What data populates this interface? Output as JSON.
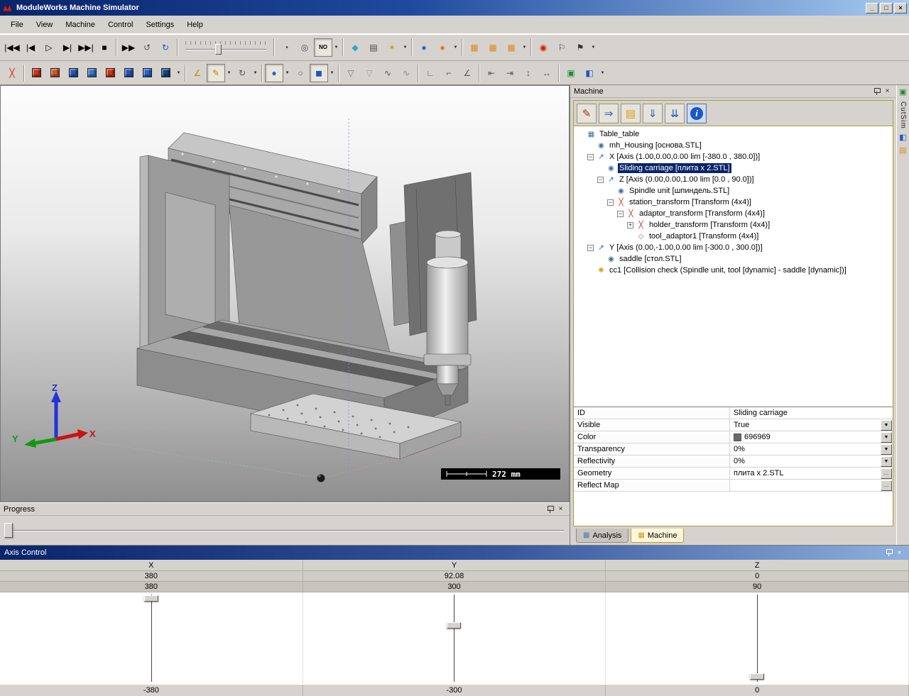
{
  "palette": {
    "titlebar_gradient_start": "#0a246a",
    "titlebar_gradient_end": "#a6caf0",
    "window_chrome": "#d6d3ce",
    "selection_blue": "#0a246a",
    "panel_frame_gold": "#b09b3c",
    "accent_blue": "#1a57c8",
    "accent_red": "#cc2200",
    "accent_orange": "#dd8822"
  },
  "window": {
    "title": "ModuleWorks Machine Simulator",
    "controls": [
      {
        "name": "minimize-button",
        "g": "_"
      },
      {
        "name": "restore-button",
        "g": "□"
      },
      {
        "name": "close-button",
        "g": "×"
      }
    ]
  },
  "menu": {
    "items": [
      "File",
      "View",
      "Machine",
      "Control",
      "Settings",
      "Help"
    ]
  },
  "toolbar1": [
    {
      "t": "btn",
      "name": "go-to-start-button",
      "g": "|◀◀"
    },
    {
      "t": "btn",
      "name": "step-back-button",
      "g": "|◀"
    },
    {
      "t": "btn",
      "name": "play-button",
      "g": "▷"
    },
    {
      "t": "btn",
      "name": "step-forward-button",
      "g": "▶|"
    },
    {
      "t": "btn",
      "name": "go-to-end-button",
      "g": "▶▶|"
    },
    {
      "t": "btn",
      "name": "stop-button",
      "g": "■"
    },
    {
      "t": "sep"
    },
    {
      "t": "btn",
      "name": "fast-forward-button",
      "g": "▶▶"
    },
    {
      "t": "btn",
      "name": "simulation-restart-button",
      "g": "↺",
      "c": "#555555"
    },
    {
      "t": "btn",
      "name": "refresh-simulation-button",
      "g": "↻",
      "c": "#1a57c8"
    },
    {
      "t": "sep"
    },
    {
      "t": "slider",
      "name": "simulation-speed-slider"
    },
    {
      "t": "sep"
    },
    {
      "t": "btn",
      "name": "clock-speed-button",
      "g": "◔",
      "c": "#333333"
    },
    {
      "t": "btn",
      "name": "gauge-speed-button",
      "g": "◎",
      "c": "#555555"
    },
    {
      "t": "btn",
      "name": "no-speed-limit-button",
      "g": "NO",
      "small": true,
      "pressed": true
    },
    {
      "t": "dd"
    },
    {
      "t": "sep"
    },
    {
      "t": "btn",
      "name": "gem-quality-button",
      "g": "◆",
      "c": "#2aa8c8"
    },
    {
      "t": "btn",
      "name": "keyboard-control-button",
      "g": "▤",
      "c": "#444444"
    },
    {
      "t": "btn",
      "name": "machine-settings-button",
      "g": "✶",
      "c": "#c8a020"
    },
    {
      "t": "dd"
    },
    {
      "t": "sep"
    },
    {
      "t": "btn",
      "name": "world-view-button",
      "g": "●",
      "c": "#2266cc"
    },
    {
      "t": "btn",
      "name": "material-sphere-button",
      "g": "●",
      "c": "#dd7711"
    },
    {
      "t": "dd"
    },
    {
      "t": "sep"
    },
    {
      "t": "btn",
      "name": "stock-wireframe-button",
      "g": "▦",
      "c": "#dd8822"
    },
    {
      "t": "btn",
      "name": "stock-solid-button",
      "g": "▦",
      "c": "#dd8822"
    },
    {
      "t": "btn",
      "name": "stock-transparent-button",
      "g": "▦",
      "c": "#dd8822"
    },
    {
      "t": "dd"
    },
    {
      "t": "sep"
    },
    {
      "t": "btn",
      "name": "marker-pin-button",
      "g": "◉",
      "c": "#cc2200"
    },
    {
      "t": "btn",
      "name": "flag-outline-button",
      "g": "⚐",
      "c": "#333333"
    },
    {
      "t": "btn",
      "name": "flag-solid-button",
      "g": "⚑",
      "c": "#333333"
    },
    {
      "t": "dd"
    }
  ],
  "toolbar2": [
    {
      "t": "btn",
      "name": "transform-move-button",
      "g": "╳",
      "c": "#cc2200"
    },
    {
      "t": "sep"
    },
    {
      "t": "cube",
      "name": "view-iso-button",
      "c": "#cc3311"
    },
    {
      "t": "cube",
      "name": "view-front-button",
      "c": "#cc5522"
    },
    {
      "t": "cube",
      "name": "view-back-button",
      "c": "#2255bb"
    },
    {
      "t": "cube",
      "name": "view-left-button",
      "c": "#3377cc"
    },
    {
      "t": "cube",
      "name": "view-right-button",
      "c": "#cc3311"
    },
    {
      "t": "cube",
      "name": "view-top-button",
      "c": "#2255bb"
    },
    {
      "t": "cube",
      "name": "view-bottom-button",
      "c": "#2266cc"
    },
    {
      "t": "cube",
      "name": "view-iso2-button",
      "c": "#114488"
    },
    {
      "t": "dd"
    },
    {
      "t": "sep"
    },
    {
      "t": "btn",
      "name": "measure-angle-button",
      "g": "∠",
      "c": "#b8860b"
    },
    {
      "t": "btn",
      "name": "measure-edit-button",
      "g": "✎",
      "c": "#b8860b",
      "pressed": true
    },
    {
      "t": "dd"
    },
    {
      "t": "btn",
      "name": "rotate-tool-button",
      "g": "↻",
      "c": "#555555"
    },
    {
      "t": "dd"
    },
    {
      "t": "sep"
    },
    {
      "t": "btn",
      "name": "shaded-view-button",
      "g": "●",
      "c": "#2266cc",
      "pressed": true
    },
    {
      "t": "dd"
    },
    {
      "t": "btn",
      "name": "wireframe-view-button",
      "g": "○",
      "c": "#555555"
    },
    {
      "t": "btn",
      "name": "solid-view-button",
      "g": "◼",
      "c": "#2255bb",
      "pressed": true
    },
    {
      "t": "dd"
    },
    {
      "t": "sep"
    },
    {
      "t": "btn",
      "name": "coolant-off-button",
      "g": "▽",
      "c": "#777777"
    },
    {
      "t": "btn",
      "name": "coolant-on-button",
      "g": "▽",
      "c": "#999999"
    },
    {
      "t": "btn",
      "name": "toolpath-curve-button",
      "g": "∿",
      "c": "#555555"
    },
    {
      "t": "btn",
      "name": "toolpath-curve2-button",
      "g": "∿",
      "c": "#888888"
    },
    {
      "t": "sep"
    },
    {
      "t": "btn",
      "name": "corner-detect-button",
      "g": "∟",
      "c": "#555555"
    },
    {
      "t": "btn",
      "name": "corner-radius-button",
      "g": "⌐",
      "c": "#555555"
    },
    {
      "t": "btn",
      "name": "corner-angle-button",
      "g": "∠",
      "c": "#555555"
    },
    {
      "t": "sep"
    },
    {
      "t": "btn",
      "name": "measure-width-button",
      "g": "⇤",
      "c": "#555555"
    },
    {
      "t": "btn",
      "name": "measure-length-button",
      "g": "⇥",
      "c": "#555555"
    },
    {
      "t": "btn",
      "name": "measure-height-button",
      "g": "↕",
      "c": "#555555"
    },
    {
      "t": "btn",
      "name": "measure-distance-button",
      "g": "↔",
      "c": "#555555"
    },
    {
      "t": "sep"
    },
    {
      "t": "btn",
      "name": "screenshot-button",
      "g": "▣",
      "c": "#228833"
    },
    {
      "t": "btn",
      "name": "render-export-button",
      "g": "◧",
      "c": "#2255bb"
    },
    {
      "t": "dd"
    }
  ],
  "viewport": {
    "scale_bar": "272 mm",
    "axis_labels": {
      "x": "X",
      "y": "Y",
      "z": "Z"
    },
    "axis_colors": {
      "x": "#cc0000",
      "y": "#119911",
      "z": "#2233cc"
    }
  },
  "machine_panel": {
    "title": "Machine",
    "toolbar": [
      {
        "name": "edit-machine-button",
        "g": "✎",
        "c": "#aa3322"
      },
      {
        "name": "load-machine-button",
        "g": "⇒",
        "c": "#1a57c8"
      },
      {
        "name": "open-machine-folder-button",
        "g": "▤",
        "c": "#d4a017"
      },
      {
        "name": "save-machine-button",
        "g": "⇓",
        "c": "#1a57c8"
      },
      {
        "name": "save-machine-as-button",
        "g": "⇊",
        "c": "#1a57c8"
      },
      {
        "name": "machine-info-button",
        "g": "i",
        "info": true,
        "pressed": true
      }
    ],
    "tree": [
      {
        "d": 0,
        "box": null,
        "icon": "machine-root-icon",
        "ig": "▦",
        "ic": "#3a6ea5",
        "label": "Table_table"
      },
      {
        "d": 1,
        "box": null,
        "icon": "geometry-icon",
        "ig": "◉",
        "ic": "#3a6ea5",
        "label": "mh_Housing [основа.STL]"
      },
      {
        "d": 1,
        "box": "-",
        "icon": "linear-axis-icon",
        "ig": "↗",
        "ic": "#1a57c8",
        "label": "X [Axis (1.00,0.00,0.00 lim [-380.0 , 380.0])]"
      },
      {
        "d": 2,
        "box": null,
        "icon": "geometry-icon",
        "ig": "◉",
        "ic": "#3a6ea5",
        "label": "Sliding carriage [плита x 2.STL]",
        "selected": true
      },
      {
        "d": 2,
        "box": "-",
        "icon": "linear-axis-icon",
        "ig": "↗",
        "ic": "#1a57c8",
        "label": "Z [Axis (0.00,0.00,1.00 lim [0.0 , 90.0])]"
      },
      {
        "d": 3,
        "box": null,
        "icon": "geometry-icon",
        "ig": "◉",
        "ic": "#3a6ea5",
        "label": "Spindle unit [шпиндель.STL]"
      },
      {
        "d": 3,
        "box": "-",
        "icon": "transform-icon",
        "ig": "╳",
        "ic": "#cc2200",
        "label": "station_transform [Transform (4x4)]"
      },
      {
        "d": 4,
        "box": "-",
        "icon": "transform-icon",
        "ig": "╳",
        "ic": "#cc2200",
        "label": "adaptor_transform [Transform (4x4)]"
      },
      {
        "d": 5,
        "box": "+",
        "icon": "transform-icon",
        "ig": "╳",
        "ic": "#cc2200",
        "label": "holder_transform [Transform (4x4)]"
      },
      {
        "d": 5,
        "box": null,
        "icon": "tool-adaptor-icon",
        "ig": "◇",
        "ic": "#777777",
        "label": "tool_adaptor1 [Transform (4x4)]"
      },
      {
        "d": 1,
        "box": "-",
        "icon": "linear-axis-icon",
        "ig": "↗",
        "ic": "#1a57c8",
        "label": "Y [Axis (0.00,-1.00,0.00 lim [-300.0 , 300.0])]"
      },
      {
        "d": 2,
        "box": null,
        "icon": "geometry-icon",
        "ig": "◉",
        "ic": "#3a6ea5",
        "label": "saddle [стол.STL]"
      },
      {
        "d": 1,
        "box": null,
        "icon": "collision-check-icon",
        "ig": "✱",
        "ic": "#d4a017",
        "label": "cc1 [Collision check (Spindle unit, tool [dynamic] - saddle [dynamic])]"
      }
    ],
    "properties": [
      {
        "name": "ID",
        "value": "Sliding carriage",
        "control": "text"
      },
      {
        "name": "Visible",
        "value": "True",
        "control": "dropdown"
      },
      {
        "name": "Color",
        "value": "696969",
        "control": "dropdown",
        "swatch": "#696969"
      },
      {
        "name": "Transparency",
        "value": "0%",
        "control": "dropdown"
      },
      {
        "name": "Reflectivity",
        "value": "0%",
        "control": "dropdown"
      },
      {
        "name": "Geometry",
        "value": "плита x 2.STL",
        "control": "ellipsis"
      },
      {
        "name": "Reflect Map",
        "value": "",
        "control": "ellipsis"
      }
    ],
    "tabs": [
      {
        "label": "Analysis",
        "icon": "analysis-tab-icon",
        "ig": "▩",
        "ic": "#5577aa",
        "active": false
      },
      {
        "label": "Machine",
        "icon": "machine-tab-icon",
        "ig": "▦",
        "ic": "#c8a020",
        "active": true
      }
    ]
  },
  "side_strip": {
    "items": [
      {
        "t": "icon",
        "name": "cutsim-shade-icon",
        "g": "▣",
        "c": "#228833"
      },
      {
        "t": "label",
        "text": "CutSim"
      },
      {
        "t": "icon",
        "name": "cutsim-palette-icon",
        "g": "◧",
        "c": "#2255bb"
      },
      {
        "t": "icon",
        "name": "cutsim-tool-icon",
        "g": "▤",
        "c": "#dd8822"
      }
    ]
  },
  "progress_panel": {
    "title": "Progress"
  },
  "axis_control": {
    "title": "Axis Control",
    "columns": [
      {
        "axis": "X",
        "current": "380",
        "limit_max": "380",
        "limit_min": "-380"
      },
      {
        "axis": "Y",
        "current": "92.08",
        "limit_max": "300",
        "limit_min": "-300"
      },
      {
        "axis": "Z",
        "current": "0",
        "limit_max": "90",
        "limit_min": "0"
      }
    ]
  }
}
